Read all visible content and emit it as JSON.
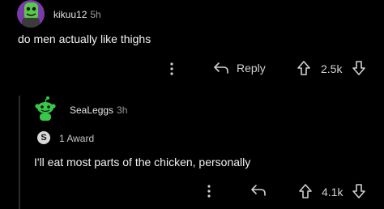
{
  "comment": {
    "author": "kikuu12",
    "time": "5h",
    "text": "do men actually like thighs",
    "reply_label": "Reply",
    "score": "2.5k"
  },
  "reply": {
    "author": "SeaLeggs",
    "time": "3h",
    "award_label": "1 Award",
    "text": "I'll eat most parts of the chicken, personally",
    "score": "4.1k"
  },
  "colors": {
    "background": "#000000",
    "avatar_purple": "#7a3aa8",
    "avatar_green": "#36c94a"
  }
}
